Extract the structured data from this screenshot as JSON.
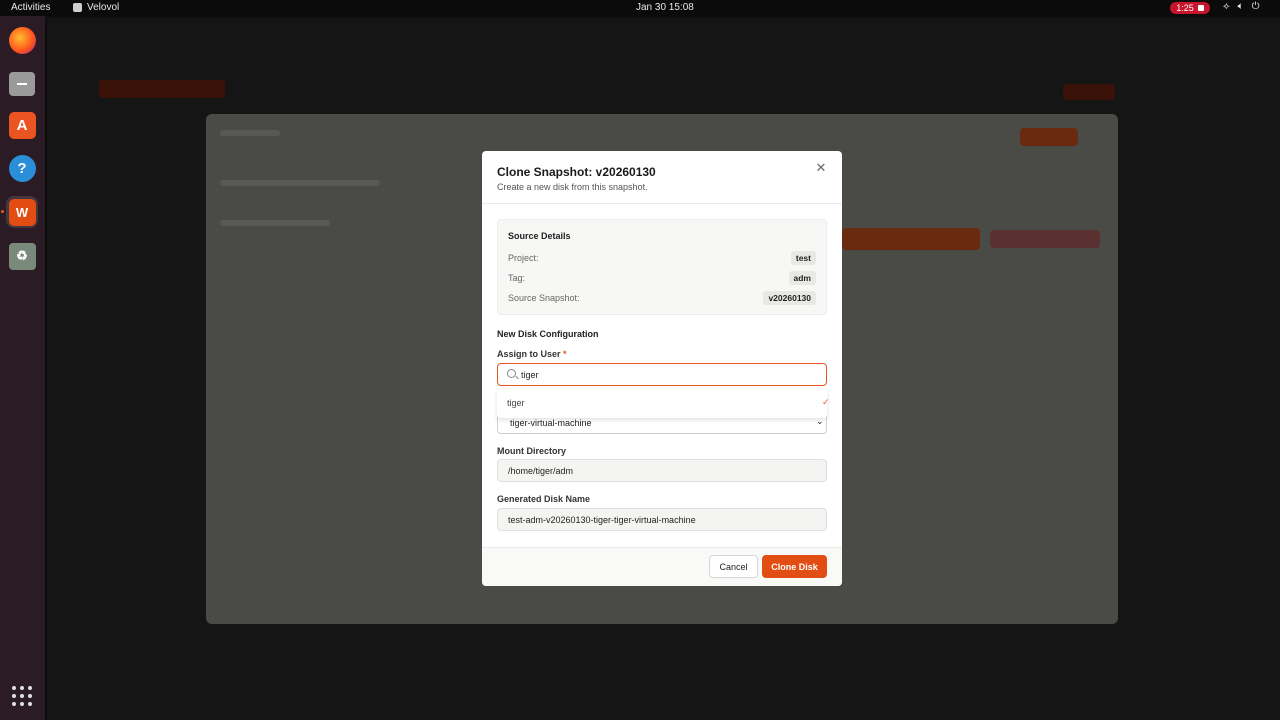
{
  "topbar": {
    "activities": "Activities",
    "app_name": "Velovol",
    "clock": "Jan 30  15:08",
    "recording": "1:25"
  },
  "dock": {
    "items": [
      "firefox-icon",
      "files-icon",
      "app-center-icon",
      "help-icon",
      "velovol-icon",
      "trash-icon"
    ]
  },
  "modal": {
    "title": "Clone Snapshot: v20260130",
    "subtitle": "Create a new disk from this snapshot.",
    "source": {
      "title": "Source Details",
      "rows": [
        {
          "label": "Project:",
          "value": "test"
        },
        {
          "label": "Tag:",
          "value": "adm"
        },
        {
          "label": "Source Snapshot:",
          "value": "v20260130"
        }
      ]
    },
    "config_title": "New Disk Configuration",
    "assign_label": "Assign to User",
    "required_mark": "*",
    "search_value": "tiger",
    "dropdown_option": "tiger",
    "machine_value": "tiger-virtual-machine",
    "mount_label": "Mount Directory",
    "mount_value": "/home/tiger/adm",
    "disk_label": "Generated Disk Name",
    "disk_value": "test-adm-v20260130-tiger-tiger-virtual-machine",
    "cancel_label": "Cancel",
    "clone_label": "Clone Disk"
  },
  "colors": {
    "accent": "#e95420",
    "primary_button": "#e24d13"
  }
}
